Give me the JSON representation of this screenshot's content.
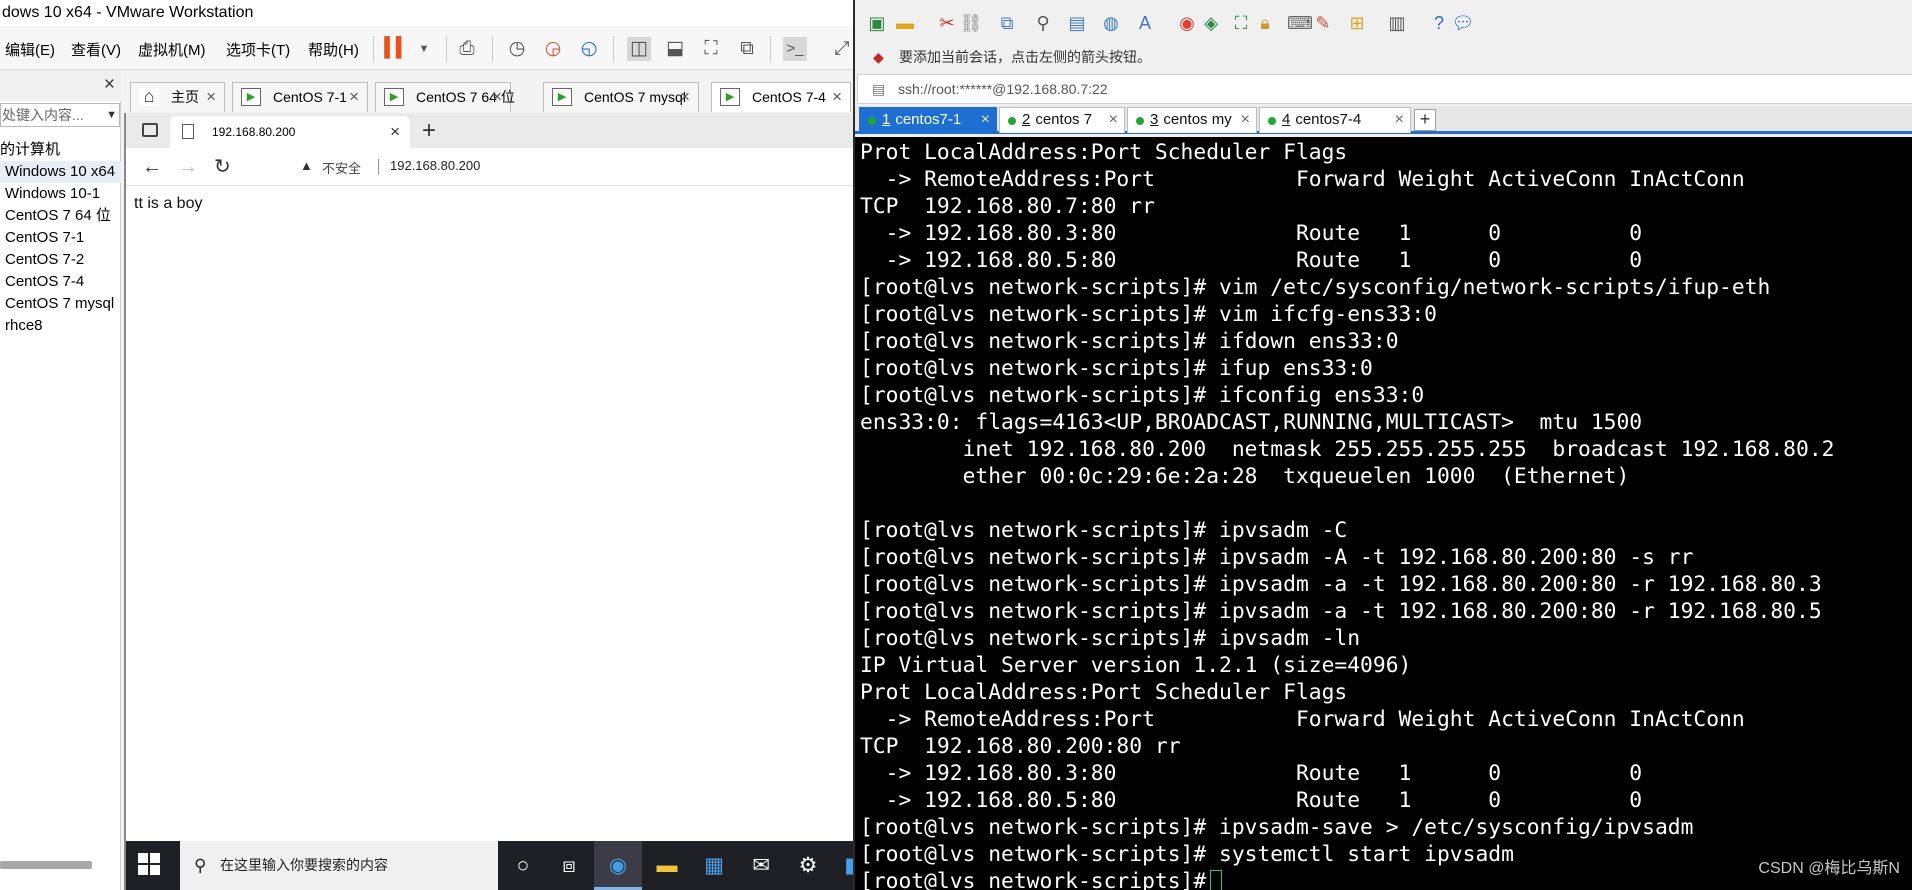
{
  "vmware": {
    "title": "dows 10 x64 - VMware Workstation",
    "menu": [
      "编辑(E)",
      "查看(V)",
      "虚拟机(M)",
      "选项卡(T)",
      "帮助(H)"
    ],
    "library": {
      "search_placeholder": "处键入内容...",
      "items": [
        "的计算机",
        "Windows 10 x64",
        "Windows 10-1",
        "CentOS 7 64 位",
        "CentOS 7-1",
        "CentOS 7-2",
        "CentOS 7-4",
        "CentOS 7 mysql",
        "rhce8"
      ]
    },
    "tabs": [
      "主页",
      "CentOS 7-1",
      "CentOS 7 64 位",
      "CentOS 7 mysql",
      "CentOS 7-4"
    ]
  },
  "browser": {
    "tab_title": "192.168.80.200",
    "insecure_label": "不安全",
    "url": "192.168.80.200",
    "page_text": "tt is a boy"
  },
  "taskbar": {
    "search_placeholder": "在这里输入你要搜索的内容"
  },
  "xshell": {
    "hint": "要添加当前会话，点击左侧的箭头按钮。",
    "address": "ssh://root:******@192.168.80.7:22",
    "tabs": [
      {
        "num": "1",
        "label": "centos7-1"
      },
      {
        "num": "2",
        "label": "centos 7"
      },
      {
        "num": "3",
        "label": "centos my"
      },
      {
        "num": "4",
        "label": "centos7-4"
      }
    ],
    "terminal_lines": [
      "Prot LocalAddress:Port Scheduler Flags",
      "  -> RemoteAddress:Port           Forward Weight ActiveConn InActConn",
      "TCP  192.168.80.7:80 rr",
      "  -> 192.168.80.3:80              Route   1      0          0",
      "  -> 192.168.80.5:80              Route   1      0          0",
      "[root@lvs network-scripts]# vim /etc/sysconfig/network-scripts/ifup-eth",
      "[root@lvs network-scripts]# vim ifcfg-ens33:0",
      "[root@lvs network-scripts]# ifdown ens33:0",
      "[root@lvs network-scripts]# ifup ens33:0",
      "[root@lvs network-scripts]# ifconfig ens33:0",
      "ens33:0: flags=4163<UP,BROADCAST,RUNNING,MULTICAST>  mtu 1500",
      "        inet 192.168.80.200  netmask 255.255.255.255  broadcast 192.168.80.2",
      "        ether 00:0c:29:6e:2a:28  txqueuelen 1000  (Ethernet)",
      "",
      "[root@lvs network-scripts]# ipvsadm -C",
      "[root@lvs network-scripts]# ipvsadm -A -t 192.168.80.200:80 -s rr",
      "[root@lvs network-scripts]# ipvsadm -a -t 192.168.80.200:80 -r 192.168.80.3",
      "[root@lvs network-scripts]# ipvsadm -a -t 192.168.80.200:80 -r 192.168.80.5",
      "[root@lvs network-scripts]# ipvsadm -ln",
      "IP Virtual Server version 1.2.1 (size=4096)",
      "Prot LocalAddress:Port Scheduler Flags",
      "  -> RemoteAddress:Port           Forward Weight ActiveConn InActConn",
      "TCP  192.168.80.200:80 rr",
      "  -> 192.168.80.3:80              Route   1      0          0",
      "  -> 192.168.80.5:80              Route   1      0          0",
      "[root@lvs network-scripts]# ipvsadm-save > /etc/sysconfig/ipvsadm",
      "[root@lvs network-scripts]# systemctl start ipvsadm"
    ],
    "prompt": "[root@lvs network-scripts]#",
    "watermark": "CSDN @梅比乌斯N"
  },
  "colors": {
    "xshell_accent": "#1e6fd1",
    "terminal_bg": "#000000",
    "terminal_fg": "#ffffff",
    "cursor": "#22d15a",
    "vmware_pause": "#e8501e"
  },
  "icons": [
    "pause-icon",
    "snapshot-icon",
    "fullscreen-icon",
    "console-icon",
    "home-icon",
    "vm-play-icon",
    "page-icon",
    "back-arrow-icon",
    "forward-arrow-icon",
    "refresh-icon",
    "warning-icon",
    "windows-start-icon",
    "search-icon",
    "edge-icon",
    "folder-icon",
    "store-icon",
    "mail-icon",
    "gear-icon",
    "help-icon",
    "lock-icon"
  ]
}
